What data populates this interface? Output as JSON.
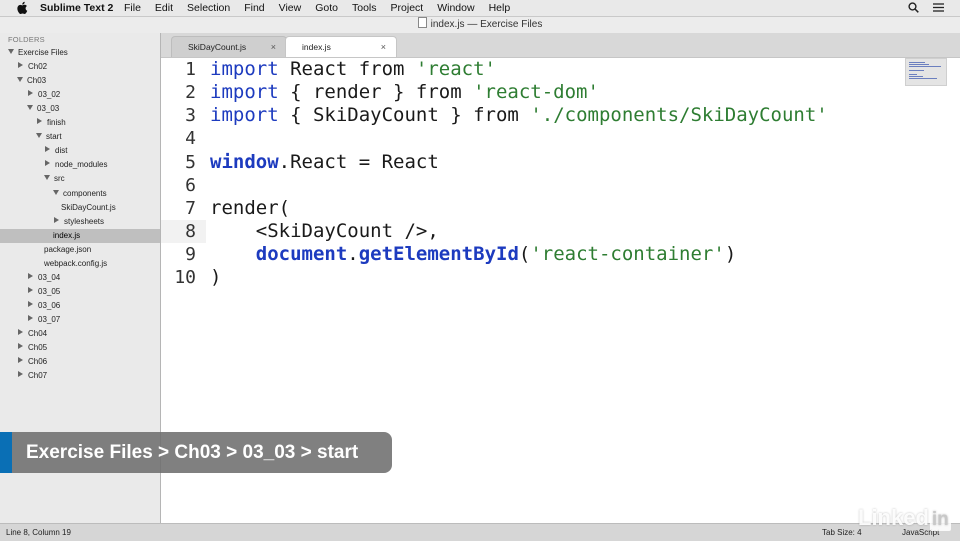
{
  "menubar": {
    "app_name": "Sublime Text 2",
    "menus": [
      "File",
      "Edit",
      "Selection",
      "Find",
      "View",
      "Goto",
      "Tools",
      "Project",
      "Window",
      "Help"
    ],
    "right_icons": [
      "search-icon",
      "list-icon"
    ]
  },
  "window": {
    "title": "index.js — Exercise Files"
  },
  "sidebar": {
    "title": "FOLDERS",
    "items": [
      {
        "label": "Exercise Files",
        "depth": 0,
        "state": "open"
      },
      {
        "label": "Ch02",
        "depth": 1,
        "state": "closed"
      },
      {
        "label": "Ch03",
        "depth": 1,
        "state": "open"
      },
      {
        "label": "03_02",
        "depth": 2,
        "state": "closed"
      },
      {
        "label": "03_03",
        "depth": 2,
        "state": "open"
      },
      {
        "label": "finish",
        "depth": 3,
        "state": "closed"
      },
      {
        "label": "start",
        "depth": 3,
        "state": "open"
      },
      {
        "label": "dist",
        "depth": 4,
        "state": "closed"
      },
      {
        "label": "node_modules",
        "depth": 4,
        "state": "closed"
      },
      {
        "label": "src",
        "depth": 4,
        "state": "open"
      },
      {
        "label": "components",
        "depth": 5,
        "state": "open"
      },
      {
        "label": "SkiDayCount.js",
        "depth": 6,
        "state": "file"
      },
      {
        "label": "stylesheets",
        "depth": 5,
        "state": "closed"
      },
      {
        "label": "index.js",
        "depth": 5,
        "state": "file",
        "selected": true
      },
      {
        "label": "package.json",
        "depth": 4,
        "state": "file"
      },
      {
        "label": "webpack.config.js",
        "depth": 4,
        "state": "file"
      },
      {
        "label": "03_04",
        "depth": 2,
        "state": "closed"
      },
      {
        "label": "03_05",
        "depth": 2,
        "state": "closed"
      },
      {
        "label": "03_06",
        "depth": 2,
        "state": "closed"
      },
      {
        "label": "03_07",
        "depth": 2,
        "state": "closed"
      },
      {
        "label": "Ch04",
        "depth": 1,
        "state": "closed"
      },
      {
        "label": "Ch05",
        "depth": 1,
        "state": "closed"
      },
      {
        "label": "Ch06",
        "depth": 1,
        "state": "closed"
      },
      {
        "label": "Ch07",
        "depth": 1,
        "state": "closed"
      }
    ]
  },
  "tabs": [
    {
      "label": "SkiDayCount.js",
      "close": "×",
      "active": false
    },
    {
      "label": "index.js",
      "close": "×",
      "active": true
    }
  ],
  "editor": {
    "current_line": 8,
    "lines": [
      {
        "n": "1",
        "tokens": [
          {
            "t": "import",
            "c": "kw"
          },
          {
            "t": " React from "
          },
          {
            "t": "'react'",
            "c": "str"
          }
        ]
      },
      {
        "n": "2",
        "tokens": [
          {
            "t": "import",
            "c": "kw"
          },
          {
            "t": " { render } from "
          },
          {
            "t": "'react-dom'",
            "c": "str"
          }
        ]
      },
      {
        "n": "3",
        "tokens": [
          {
            "t": "import",
            "c": "kw"
          },
          {
            "t": " { SkiDayCount } from "
          },
          {
            "t": "'./components/SkiDayCount'",
            "c": "str"
          }
        ]
      },
      {
        "n": "4",
        "tokens": []
      },
      {
        "n": "5",
        "tokens": [
          {
            "t": "window",
            "c": "kw bold"
          },
          {
            "t": ".React = React"
          }
        ]
      },
      {
        "n": "6",
        "tokens": []
      },
      {
        "n": "7",
        "tokens": [
          {
            "t": "render("
          }
        ]
      },
      {
        "n": "8",
        "tokens": [
          {
            "t": "    <SkiDayCount />,"
          }
        ]
      },
      {
        "n": "9",
        "tokens": [
          {
            "t": "    "
          },
          {
            "t": "document",
            "c": "kw bold"
          },
          {
            "t": "."
          },
          {
            "t": "getElementById",
            "c": "fn bold"
          },
          {
            "t": "("
          },
          {
            "t": "'react-container'",
            "c": "str"
          },
          {
            "t": ")"
          }
        ]
      },
      {
        "n": "10",
        "tokens": [
          {
            "t": ")"
          }
        ]
      }
    ]
  },
  "breadcrumb": {
    "text": "Exercise Files > Ch03 > 03_03 > start"
  },
  "statusbar": {
    "position": "Line 8, Column 19",
    "tab_size": "Tab Size: 4",
    "syntax": "JavaScript"
  },
  "watermark": {
    "text": "Linked",
    "box": "in"
  },
  "colors": {
    "keyword": "#1d3bbf",
    "string": "#2e7d32",
    "breadcrumb_accent": "#0a6fb5"
  }
}
